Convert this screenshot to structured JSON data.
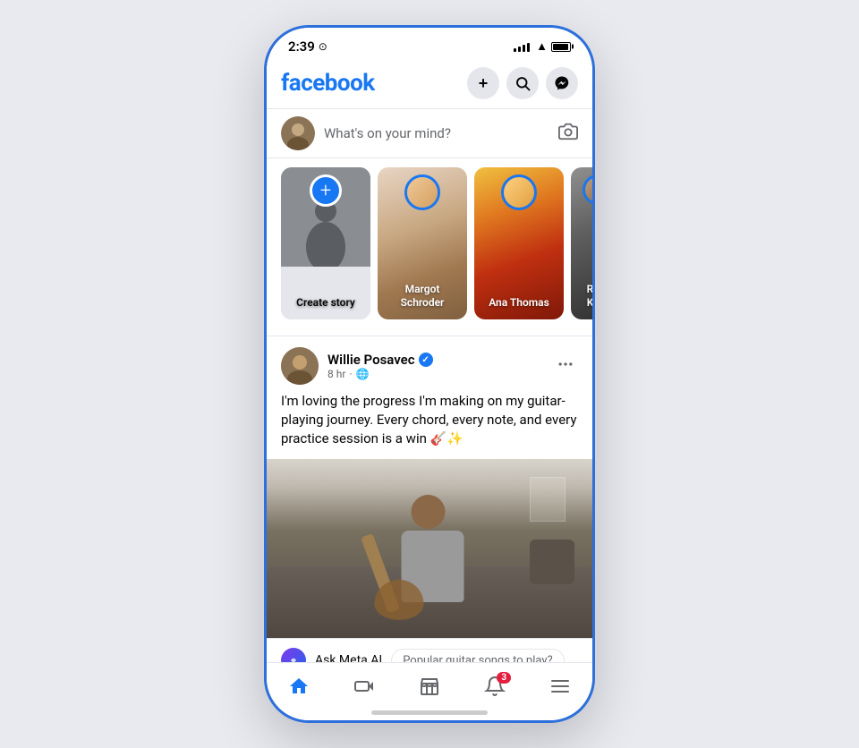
{
  "statusBar": {
    "time": "2:39",
    "clockIcon": "🕐"
  },
  "header": {
    "logo": "facebook",
    "addButton": "+",
    "searchButton": "🔍",
    "messengerButton": "💬"
  },
  "composer": {
    "placeholder": "What's on your mind?",
    "cameraIcon": "📷"
  },
  "stories": [
    {
      "type": "create",
      "label": "Create story",
      "plusIcon": "+"
    },
    {
      "type": "user",
      "name": "Margot Schroder",
      "hasRing": true
    },
    {
      "type": "user",
      "name": "Ana Thomas",
      "hasRing": true
    },
    {
      "type": "user",
      "name": "Reer Kum",
      "hasRing": true
    }
  ],
  "post": {
    "userName": "Willie Posavec",
    "verified": true,
    "time": "8 hr",
    "privacy": "🌐",
    "text": "I'm loving the progress I'm making on my guitar-playing journey. Every chord, every note, and every practice session is a win 🎸✨",
    "moreIcon": "•••"
  },
  "metaAI": {
    "label": "Ask Meta AI",
    "suggestion": "Popular guitar songs to play?"
  },
  "bottomNav": {
    "items": [
      {
        "icon": "home",
        "active": true,
        "label": "Home"
      },
      {
        "icon": "video",
        "active": false,
        "label": "Video"
      },
      {
        "icon": "store",
        "active": false,
        "label": "Marketplace"
      },
      {
        "icon": "bell",
        "active": false,
        "label": "Notifications",
        "badge": "3"
      },
      {
        "icon": "menu",
        "active": false,
        "label": "Menu"
      }
    ]
  },
  "colors": {
    "brand": "#1877f2",
    "verified": "#1877f2",
    "badge": "#e41e3f",
    "text": "#050505",
    "secondary": "#65676b"
  }
}
